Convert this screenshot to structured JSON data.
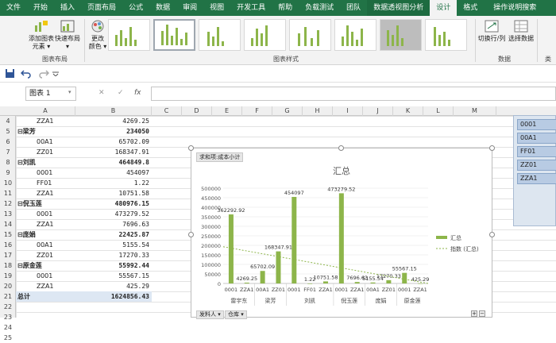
{
  "tabs": [
    {
      "label": "文件"
    },
    {
      "label": "开始"
    },
    {
      "label": "插入"
    },
    {
      "label": "页面布局"
    },
    {
      "label": "公式"
    },
    {
      "label": "数据"
    },
    {
      "label": "审阅"
    },
    {
      "label": "视图"
    },
    {
      "label": "开发工具"
    },
    {
      "label": "帮助"
    },
    {
      "label": "负载测试"
    },
    {
      "label": "团队"
    },
    {
      "label": "数据透视图分析"
    },
    {
      "label": "设计"
    },
    {
      "label": "格式"
    },
    {
      "label": "操作说明搜索"
    }
  ],
  "ribbon": {
    "add_element": "添加图表\n元素 ▾",
    "quick_layout": "快速布局\n▾",
    "change_color": "更改\n颜色 ▾",
    "group_layout": "图表布局",
    "group_styles": "图表样式",
    "switch_rowcol": "切换行/列",
    "select_data": "选择数据",
    "group_data": "数据",
    "group_type": "类"
  },
  "formula_bar": {
    "name_box": "图表 1",
    "cancel": "✕",
    "enter": "✓",
    "fx": "fx",
    "value": ""
  },
  "columns": [
    "A",
    "B",
    "C",
    "D",
    "E",
    "F",
    "G",
    "H",
    "I",
    "J",
    "K",
    "L",
    "M"
  ],
  "rows": [
    "4",
    "5",
    "6",
    "7",
    "8",
    "9",
    "10",
    "11",
    "12",
    "13",
    "14",
    "15",
    "16",
    "17",
    "18",
    "19",
    "20",
    "21",
    "22",
    "23",
    "24",
    "25"
  ],
  "cells": [
    {
      "a": "ZZA1",
      "b": "4269.25",
      "indent": true,
      "bold": false
    },
    {
      "a": "⊟梁芳",
      "b": "234050",
      "indent": false,
      "bold": true
    },
    {
      "a": "00A1",
      "b": "65702.09",
      "indent": true,
      "bold": false
    },
    {
      "a": "ZZ01",
      "b": "168347.91",
      "indent": true,
      "bold": false
    },
    {
      "a": "⊟刘凯",
      "b": "464849.8",
      "indent": false,
      "bold": true
    },
    {
      "a": "0001",
      "b": "454097",
      "indent": true,
      "bold": false
    },
    {
      "a": "FF01",
      "b": "1.22",
      "indent": true,
      "bold": false
    },
    {
      "a": "ZZA1",
      "b": "10751.58",
      "indent": true,
      "bold": false
    },
    {
      "a": "⊟倪玉莲",
      "b": "480976.15",
      "indent": false,
      "bold": true
    },
    {
      "a": "0001",
      "b": "473279.52",
      "indent": true,
      "bold": false
    },
    {
      "a": "ZZA1",
      "b": "7696.63",
      "indent": true,
      "bold": false
    },
    {
      "a": "⊟庞娟",
      "b": "22425.87",
      "indent": false,
      "bold": true
    },
    {
      "a": "00A1",
      "b": "5155.54",
      "indent": true,
      "bold": false
    },
    {
      "a": "ZZ01",
      "b": "17270.33",
      "indent": true,
      "bold": false
    },
    {
      "a": "⊟原金莲",
      "b": "55992.44",
      "indent": false,
      "bold": true
    },
    {
      "a": "0001",
      "b": "55567.15",
      "indent": true,
      "bold": false
    },
    {
      "a": "ZZA1",
      "b": "425.29",
      "indent": true,
      "bold": false
    },
    {
      "a": "总计",
      "b": "1624856.43",
      "indent": false,
      "bold": true
    }
  ],
  "slicer": {
    "items": [
      "0001",
      "00A1",
      "FF01",
      "ZZ01",
      "ZZA1"
    ]
  },
  "chart": {
    "field_button": "求和项:成本小计",
    "filter1": "发料人 ▾",
    "filter2": "仓库 ▾"
  },
  "chart_data": {
    "type": "bar",
    "title": "汇总",
    "ylim": [
      0,
      500000
    ],
    "yticks": [
      "0",
      "50000",
      "100000",
      "150000",
      "200000",
      "250000",
      "300000",
      "350000",
      "400000",
      "450000",
      "500000"
    ],
    "categories": [
      "0001",
      "ZZA1",
      "00A1",
      "ZZ01",
      "0001",
      "FF01",
      "ZZA1",
      "0001",
      "ZZA1",
      "00A1",
      "ZZ01",
      "0001",
      "ZZA1"
    ],
    "groups": [
      {
        "name": "雷宇东",
        "span": 2
      },
      {
        "name": "梁芳",
        "span": 2
      },
      {
        "name": "刘凯",
        "span": 3
      },
      {
        "name": "倪玉莲",
        "span": 2
      },
      {
        "name": "庞娟",
        "span": 2
      },
      {
        "name": "原金莲",
        "span": 2
      }
    ],
    "values": [
      362292.92,
      4269.25,
      65702.09,
      168347.91,
      454097,
      1.22,
      10751.58,
      473279.52,
      7696.63,
      5155.54,
      17270.33,
      55567.15,
      425.29
    ],
    "labels": [
      "362292.92",
      "4269.25",
      "65702.09",
      "168347.91",
      "454097",
      "1.22",
      "10751.58",
      "473279.52",
      "7696.63",
      "5155.54",
      "17270.33",
      "55567.15",
      "425.29"
    ],
    "legend": [
      {
        "name": "汇总"
      },
      {
        "name": "指数 (汇总)"
      }
    ],
    "legend_position": "right",
    "bar_color": "#8db54a",
    "trend_color": "#8db54a"
  }
}
